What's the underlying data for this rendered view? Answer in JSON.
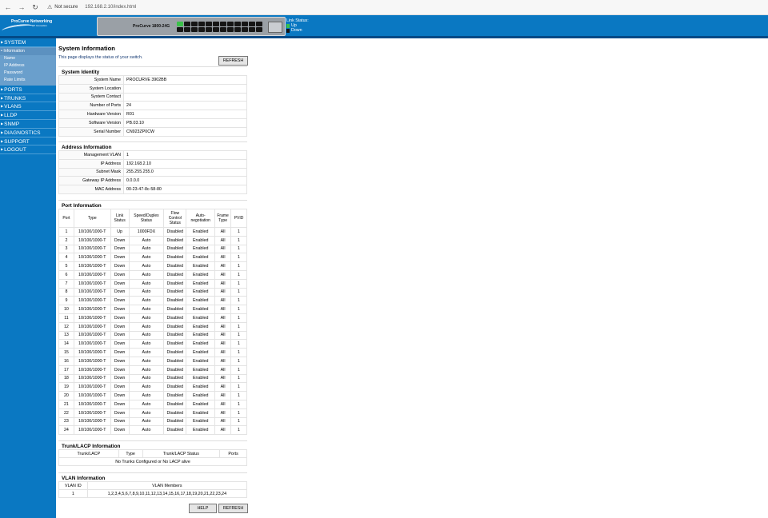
{
  "browser": {
    "security": "Not secure",
    "url": "192.168.2.10/index.html"
  },
  "header": {
    "brand": "ProCurve Networking",
    "brand_sub": "HP Innovation",
    "device_model": "ProCurve 1800-24G",
    "link_status_title": "Link Status:",
    "legend_up": "Up",
    "legend_down": "Down",
    "up_color": "#3bc14a",
    "down_color": "#151515",
    "port_up": [
      true,
      false,
      false,
      false,
      false,
      false,
      false,
      false,
      false,
      false,
      false,
      false,
      false,
      false,
      false,
      false,
      false,
      false,
      false,
      false,
      false,
      false,
      false,
      false
    ]
  },
  "sidebar": {
    "items": [
      {
        "label": "SYSTEM"
      },
      {
        "label": "PORTS"
      },
      {
        "label": "TRUNKS"
      },
      {
        "label": "VLANS"
      },
      {
        "label": "LLDP"
      },
      {
        "label": "SNMP"
      },
      {
        "label": "DIAGNOSTICS"
      },
      {
        "label": "SUPPORT"
      },
      {
        "label": "LOGOUT"
      }
    ],
    "system_sub": [
      "Information",
      "Name",
      "IP Address",
      "Password",
      "Rate Limits"
    ]
  },
  "page": {
    "title": "System Information",
    "description": "This page displays the status of your switch.",
    "refresh": "REFRESH",
    "help": "HELP"
  },
  "identity": {
    "title": "System Identity",
    "rows": [
      {
        "k": "System Name",
        "v": "PROCURVE 3902BB"
      },
      {
        "k": "System Location",
        "v": ""
      },
      {
        "k": "System Contact",
        "v": ""
      },
      {
        "k": "Number of Ports",
        "v": "24"
      },
      {
        "k": "Hardware Version",
        "v": "R01"
      },
      {
        "k": "Software Version",
        "v": "PB.03.10"
      },
      {
        "k": "Serial Number",
        "v": "CN923ZP0CW"
      }
    ]
  },
  "address": {
    "title": "Address Information",
    "rows": [
      {
        "k": "Management VLAN",
        "v": "1"
      },
      {
        "k": "IP Address",
        "v": "192.168.2.10"
      },
      {
        "k": "Subnet Mask",
        "v": "255.255.255.0"
      },
      {
        "k": "Gateway IP Address",
        "v": "0.0.0.0"
      },
      {
        "k": "MAC Address",
        "v": "00-23-47-8c-58-80"
      }
    ]
  },
  "ports": {
    "title": "Port Information",
    "headers": [
      "Port",
      "Type",
      "Link Status",
      "Speed/Duplex Status",
      "Flow Control Status",
      "Auto-negotiation",
      "Frame Type",
      "PVID"
    ],
    "rows": [
      [
        "1",
        "10/100/1000-T",
        "Up",
        "1000FDX",
        "Disabled",
        "Enabled",
        "All",
        "1"
      ],
      [
        "2",
        "10/100/1000-T",
        "Down",
        "Auto",
        "Disabled",
        "Enabled",
        "All",
        "1"
      ],
      [
        "3",
        "10/100/1000-T",
        "Down",
        "Auto",
        "Disabled",
        "Enabled",
        "All",
        "1"
      ],
      [
        "4",
        "10/100/1000-T",
        "Down",
        "Auto",
        "Disabled",
        "Enabled",
        "All",
        "1"
      ],
      [
        "5",
        "10/100/1000-T",
        "Down",
        "Auto",
        "Disabled",
        "Enabled",
        "All",
        "1"
      ],
      [
        "6",
        "10/100/1000-T",
        "Down",
        "Auto",
        "Disabled",
        "Enabled",
        "All",
        "1"
      ],
      [
        "7",
        "10/100/1000-T",
        "Down",
        "Auto",
        "Disabled",
        "Enabled",
        "All",
        "1"
      ],
      [
        "8",
        "10/100/1000-T",
        "Down",
        "Auto",
        "Disabled",
        "Enabled",
        "All",
        "1"
      ],
      [
        "9",
        "10/100/1000-T",
        "Down",
        "Auto",
        "Disabled",
        "Enabled",
        "All",
        "1"
      ],
      [
        "10",
        "10/100/1000-T",
        "Down",
        "Auto",
        "Disabled",
        "Enabled",
        "All",
        "1"
      ],
      [
        "11",
        "10/100/1000-T",
        "Down",
        "Auto",
        "Disabled",
        "Enabled",
        "All",
        "1"
      ],
      [
        "12",
        "10/100/1000-T",
        "Down",
        "Auto",
        "Disabled",
        "Enabled",
        "All",
        "1"
      ],
      [
        "13",
        "10/100/1000-T",
        "Down",
        "Auto",
        "Disabled",
        "Enabled",
        "All",
        "1"
      ],
      [
        "14",
        "10/100/1000-T",
        "Down",
        "Auto",
        "Disabled",
        "Enabled",
        "All",
        "1"
      ],
      [
        "15",
        "10/100/1000-T",
        "Down",
        "Auto",
        "Disabled",
        "Enabled",
        "All",
        "1"
      ],
      [
        "16",
        "10/100/1000-T",
        "Down",
        "Auto",
        "Disabled",
        "Enabled",
        "All",
        "1"
      ],
      [
        "17",
        "10/100/1000-T",
        "Down",
        "Auto",
        "Disabled",
        "Enabled",
        "All",
        "1"
      ],
      [
        "18",
        "10/100/1000-T",
        "Down",
        "Auto",
        "Disabled",
        "Enabled",
        "All",
        "1"
      ],
      [
        "19",
        "10/100/1000-T",
        "Down",
        "Auto",
        "Disabled",
        "Enabled",
        "All",
        "1"
      ],
      [
        "20",
        "10/100/1000-T",
        "Down",
        "Auto",
        "Disabled",
        "Enabled",
        "All",
        "1"
      ],
      [
        "21",
        "10/100/1000-T",
        "Down",
        "Auto",
        "Disabled",
        "Enabled",
        "All",
        "1"
      ],
      [
        "22",
        "10/100/1000-T",
        "Down",
        "Auto",
        "Disabled",
        "Enabled",
        "All",
        "1"
      ],
      [
        "23",
        "10/100/1000-T",
        "Down",
        "Auto",
        "Disabled",
        "Enabled",
        "All",
        "1"
      ],
      [
        "24",
        "10/100/1000-T",
        "Down",
        "Auto",
        "Disabled",
        "Enabled",
        "All",
        "1"
      ]
    ]
  },
  "trunks": {
    "title": "Trunk/LACP Information",
    "headers": [
      "Trunk/LACP",
      "Type",
      "Trunk/LACP Status",
      "Ports"
    ],
    "empty": "No Trunks Configured or No LACP alive"
  },
  "vlan": {
    "title": "VLAN Information",
    "headers": [
      "VLAN ID",
      "VLAN Members"
    ],
    "rows": [
      [
        "1",
        "1,2,3,4,5,6,7,8,9,10,11,12,13,14,15,16,17,18,19,20,21,22,23,24"
      ]
    ]
  }
}
